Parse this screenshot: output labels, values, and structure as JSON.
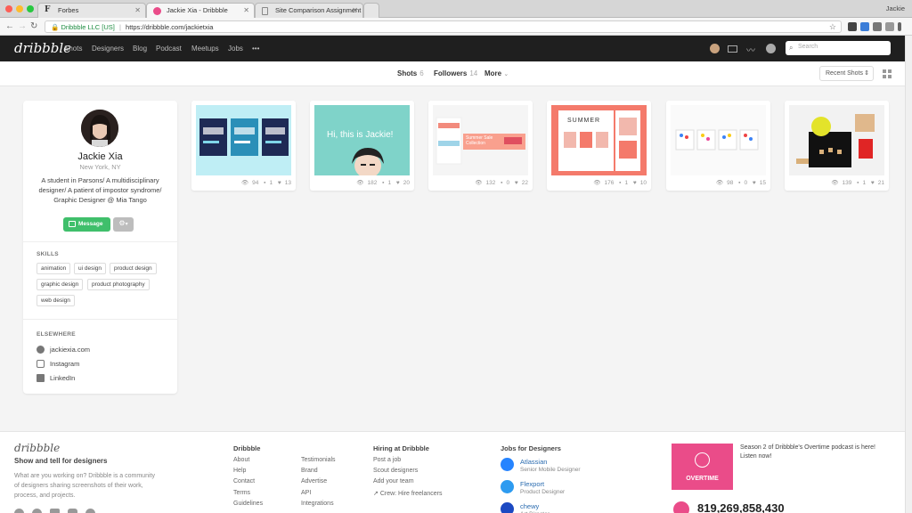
{
  "browser": {
    "tabs": [
      {
        "label": "Forbes"
      },
      {
        "label": "Jackie Xia - Dribbble"
      },
      {
        "label": "Site Comparison Assignment"
      }
    ],
    "user": "Jackie",
    "url": {
      "secure_label": "Dribbble LLC [US]",
      "address": "https://dribbble.com/jackietxia"
    }
  },
  "header": {
    "logo": "dribbble",
    "nav": [
      "Shots",
      "Designers",
      "Blog",
      "Podcast",
      "Meetups",
      "Jobs"
    ],
    "more": "•••",
    "search_placeholder": "Search"
  },
  "subnav": {
    "shots_label": "Shots",
    "shots_count": "6",
    "followers_label": "Followers",
    "followers_count": "14",
    "more_label": "More",
    "sort_label": "Recent Shots"
  },
  "profile": {
    "name": "Jackie Xia",
    "location": "New York, NY",
    "bio": "A student in Parsons/ A multidisciplinary designer/ A patient of impostor syndrome/ Graphic Designer @ Mia Tango",
    "message_label": "Message",
    "skills_heading": "SKILLS",
    "skills": [
      "animation",
      "ui design",
      "product design",
      "graphic design",
      "product photography",
      "web design"
    ],
    "elsewhere_heading": "ELSEWHERE",
    "links": [
      "jackiexia.com",
      "Instagram",
      "LinkedIn"
    ]
  },
  "shots": [
    {
      "views": "94",
      "comments": "1",
      "likes": "13",
      "thumb_text": ""
    },
    {
      "views": "182",
      "comments": "1",
      "likes": "20",
      "thumb_text": "Hi, this is Jackie!"
    },
    {
      "views": "132",
      "comments": "0",
      "likes": "22",
      "thumb_text": "Summer Sale Collection"
    },
    {
      "views": "176",
      "comments": "1",
      "likes": "10",
      "thumb_text": "SUMMER"
    },
    {
      "views": "98",
      "comments": "0",
      "likes": "15",
      "thumb_text": ""
    },
    {
      "views": "139",
      "comments": "1",
      "likes": "21",
      "thumb_text": ""
    }
  ],
  "footer": {
    "logo": "dribbble",
    "tagline": "Show and tell for designers",
    "description": "What are you working on? Dribbble is a community of designers sharing screenshots of their work, process, and projects.",
    "col1_heading": "Dribbble",
    "col1_links": [
      "About",
      "Help",
      "Contact",
      "Terms",
      "Guidelines"
    ],
    "col2_links": [
      "Testimonials",
      "Brand",
      "Advertise",
      "API",
      "Integrations"
    ],
    "col3_heading": "Hiring at Dribbble",
    "col3_links": [
      "Post a job",
      "Scout designers",
      "Add your team",
      "Crew: Hire freelancers"
    ],
    "jobs_heading": "Jobs for Designers",
    "jobs": [
      {
        "company": "Atlassian",
        "role": "Senior Mobile Designer",
        "color": "#2684ff"
      },
      {
        "company": "Flexport",
        "role": "Product Designer",
        "color": "#2d9bf0"
      },
      {
        "company": "chewy",
        "role": "Art Director",
        "color": "#1c49c2"
      }
    ],
    "overtime_label": "OVERTIME",
    "overtime_text": "Season 2 of Dribbble's Overtime podcast is here! Listen now!",
    "shots_count": "819,269,858,430"
  },
  "colors": {
    "brand_pink": "#ea4c89",
    "message_green": "#3fbf6b",
    "header_dark": "#1f1f1f"
  }
}
